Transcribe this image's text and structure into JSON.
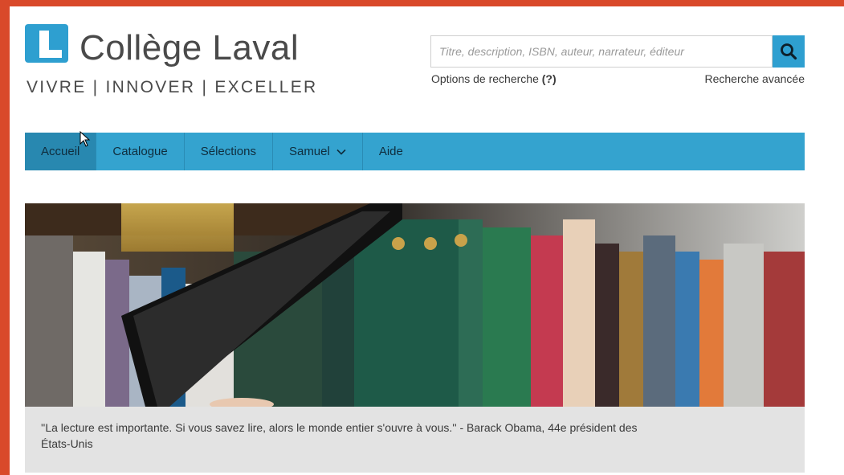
{
  "brand": {
    "name": "Collège Laval",
    "tagline": "VIVRE | INNOVER | EXCELLER",
    "color": "#2e9fd0",
    "text_color": "#4a4a4a"
  },
  "search": {
    "placeholder": "Titre, description, ISBN, auteur, narrateur, éditeur",
    "value": "",
    "button_icon": "search-icon",
    "options_label": "Options de recherche ",
    "options_help": "(?)",
    "advanced_label": "Recherche avancée"
  },
  "nav": {
    "color": "#34a3cf",
    "items": [
      {
        "label": "Accueil",
        "active": true
      },
      {
        "label": "Catalogue",
        "active": false
      },
      {
        "label": "Sélections",
        "active": false
      },
      {
        "label": "Samuel",
        "active": false,
        "icon": "chevron-down-icon"
      },
      {
        "label": "Aide",
        "active": false
      }
    ]
  },
  "hero": {
    "caption_line1": "''La lecture est importante. Si vous savez lire, alors le monde entier s'ouvre à vous.'' - Barack Obama, 44e président des",
    "caption_line2": "États-Unis"
  },
  "frame": {
    "accent": "#d9492a"
  }
}
